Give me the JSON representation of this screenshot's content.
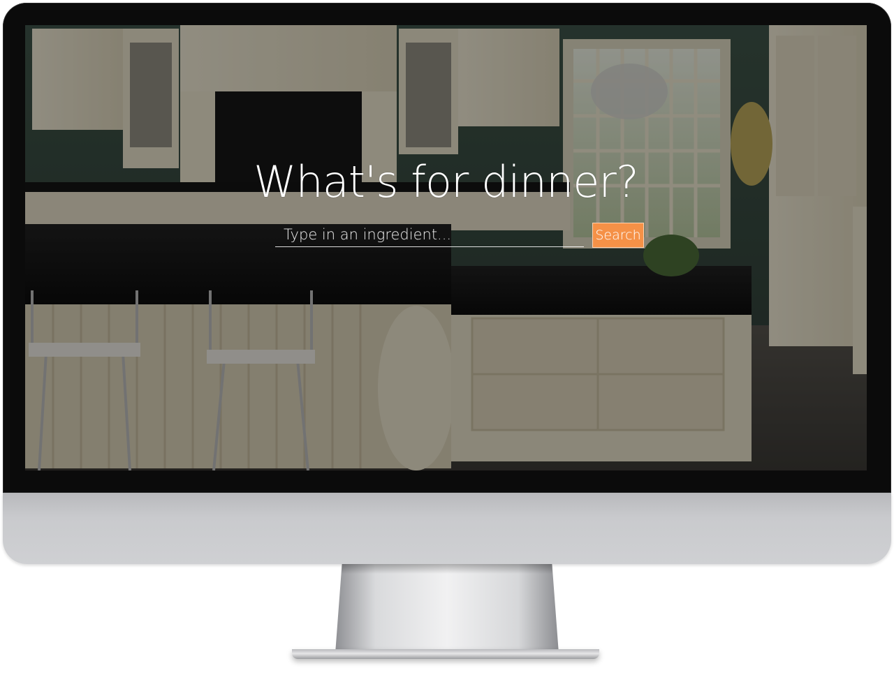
{
  "hero": {
    "title": "What's for dinner?"
  },
  "search": {
    "placeholder": "Type in an ingredient...",
    "value": "",
    "button_label": "Search"
  },
  "colors": {
    "accent": "#f59147",
    "overlay": "#000000",
    "bezel": "#0b0b0b",
    "chin": "#cfd0d3"
  }
}
